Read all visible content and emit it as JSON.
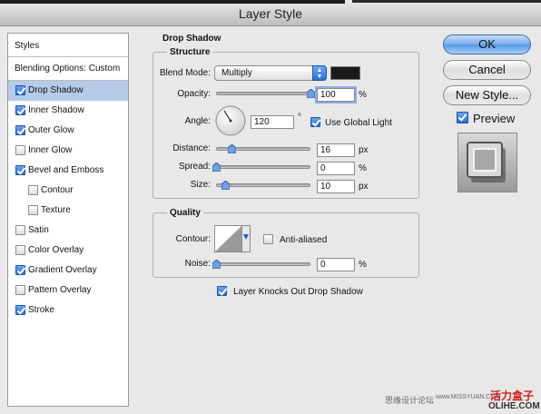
{
  "window": {
    "title": "Layer Style"
  },
  "styles_panel": {
    "header": "Styles",
    "blending_options": "Blending Options: Custom",
    "items": [
      {
        "label": "Drop Shadow",
        "checked": true,
        "selected": true,
        "indent": false
      },
      {
        "label": "Inner Shadow",
        "checked": true,
        "selected": false,
        "indent": false
      },
      {
        "label": "Outer Glow",
        "checked": true,
        "selected": false,
        "indent": false
      },
      {
        "label": "Inner Glow",
        "checked": false,
        "selected": false,
        "indent": false
      },
      {
        "label": "Bevel and Emboss",
        "checked": true,
        "selected": false,
        "indent": false
      },
      {
        "label": "Contour",
        "checked": false,
        "selected": false,
        "indent": true
      },
      {
        "label": "Texture",
        "checked": false,
        "selected": false,
        "indent": true
      },
      {
        "label": "Satin",
        "checked": false,
        "selected": false,
        "indent": false
      },
      {
        "label": "Color Overlay",
        "checked": false,
        "selected": false,
        "indent": false
      },
      {
        "label": "Gradient Overlay",
        "checked": true,
        "selected": false,
        "indent": false
      },
      {
        "label": "Pattern Overlay",
        "checked": false,
        "selected": false,
        "indent": false
      },
      {
        "label": "Stroke",
        "checked": true,
        "selected": false,
        "indent": false
      }
    ]
  },
  "drop_shadow": {
    "group_title": "Drop Shadow",
    "structure": {
      "title": "Structure",
      "blend_mode_label": "Blend Mode:",
      "blend_mode_value": "Multiply",
      "shadow_color": "#1b1b1b",
      "opacity_label": "Opacity:",
      "opacity_value": "100",
      "opacity_unit": "%",
      "opacity_slider": 1.0,
      "angle_label": "Angle:",
      "angle_value": "120",
      "angle_unit": "°",
      "use_global_light_label": "Use Global Light",
      "use_global_light_checked": true,
      "distance_label": "Distance:",
      "distance_value": "16",
      "distance_unit": "px",
      "distance_slider": 0.16,
      "spread_label": "Spread:",
      "spread_value": "0",
      "spread_unit": "%",
      "spread_slider": 0.0,
      "size_label": "Size:",
      "size_value": "10",
      "size_unit": "px",
      "size_slider": 0.1
    },
    "quality": {
      "title": "Quality",
      "contour_label": "Contour:",
      "anti_aliased_label": "Anti-aliased",
      "anti_aliased_checked": false,
      "noise_label": "Noise:",
      "noise_value": "0",
      "noise_unit": "%",
      "noise_slider": 0.0
    },
    "knocks_out_label": "Layer Knocks Out Drop Shadow",
    "knocks_out_checked": true
  },
  "buttons": {
    "ok": "OK",
    "cancel": "Cancel",
    "new_style": "New Style...",
    "preview_label": "Preview",
    "preview_checked": true
  },
  "watermark": {
    "left": "思缘设计论坛",
    "url": "www.MISSYUAN.COM",
    "brand_cn": "活力盒子",
    "brand_en": "OLIHE.COM"
  }
}
